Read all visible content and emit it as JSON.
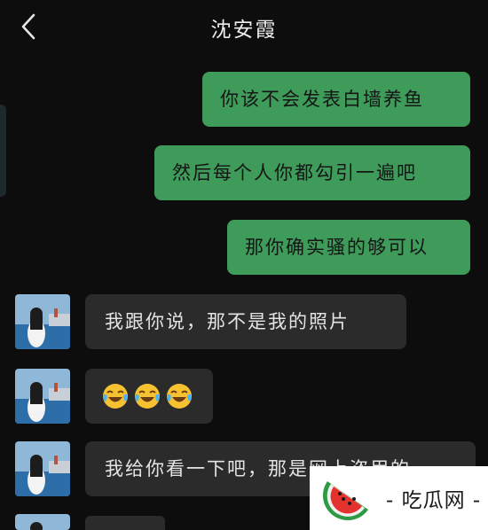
{
  "header": {
    "back_icon": "chevron-left-icon",
    "title": "沈安霞"
  },
  "messages": [
    {
      "side": "sent",
      "text": "你该不会发表白墙养鱼"
    },
    {
      "side": "sent",
      "text": "然后每个人你都勾引一遍吧"
    },
    {
      "side": "sent",
      "text": "那你确实骚的够可以"
    },
    {
      "side": "received",
      "text": "我跟你说，那不是我的照片"
    },
    {
      "side": "received",
      "emoji": [
        "face-with-tears-of-joy",
        "face-with-tears-of-joy",
        "face-with-tears-of-joy"
      ]
    },
    {
      "side": "received",
      "text": "我给你看一下吧，那是网上盗用的"
    }
  ],
  "watermark": {
    "text": "- 吃瓜网 -",
    "logo": "watermelon-logo"
  },
  "colors": {
    "background": "#0d0d0d",
    "sent_bubble": "#3e9b5a",
    "received_bubble": "#2b2b2b"
  }
}
